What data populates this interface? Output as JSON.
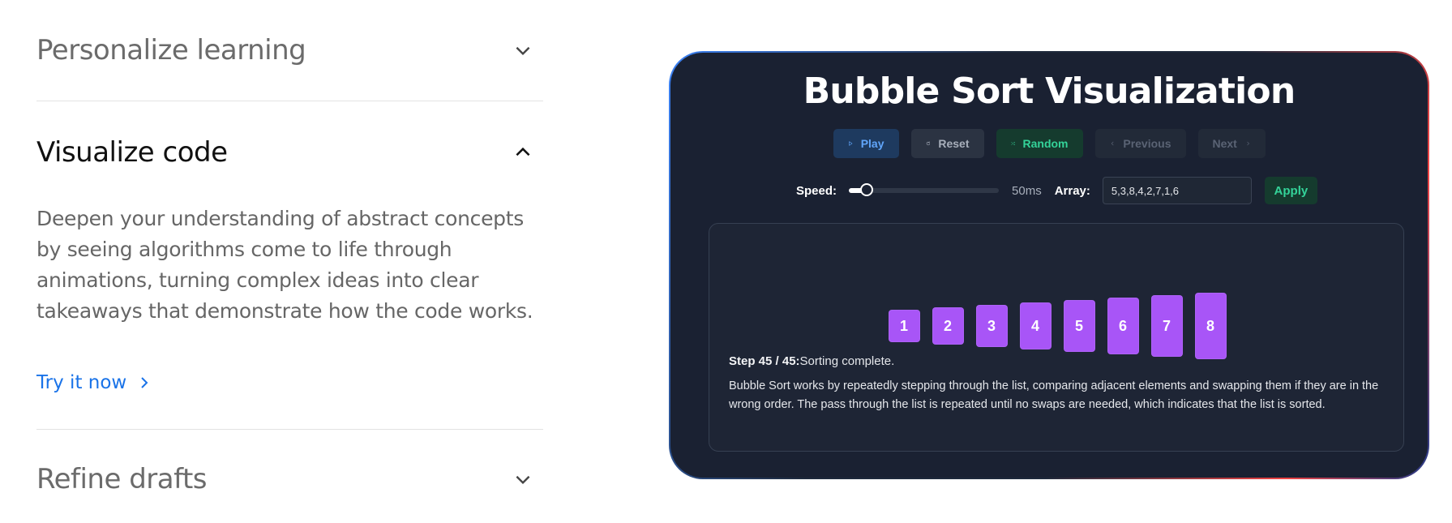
{
  "accordion": {
    "items": [
      {
        "title": "Personalize learning",
        "expanded": false,
        "chevron": "chevron-down-icon"
      },
      {
        "title": "Visualize code",
        "expanded": true,
        "chevron": "chevron-up-icon",
        "description": "Deepen your understanding of abstract concepts by seeing algorithms come to life through animations, turning complex ideas into clear takeaways that demonstrate how the code works.",
        "link_label": "Try it now"
      },
      {
        "title": "Refine drafts",
        "expanded": false,
        "chevron": "chevron-down-icon"
      }
    ]
  },
  "demo": {
    "title": "Bubble Sort Visualization",
    "controls": {
      "play": "Play",
      "reset": "Reset",
      "random": "Random",
      "previous": "Previous",
      "next": "Next"
    },
    "speed_label": "Speed:",
    "speed_value": "50ms",
    "speed_level": 0.12,
    "array_label": "Array:",
    "array_value": "5,3,8,4,2,7,1,6",
    "apply_label": "Apply",
    "bars": [
      {
        "value": "1",
        "n": 1
      },
      {
        "value": "2",
        "n": 2
      },
      {
        "value": "3",
        "n": 3
      },
      {
        "value": "4",
        "n": 4
      },
      {
        "value": "5",
        "n": 5
      },
      {
        "value": "6",
        "n": 6
      },
      {
        "value": "7",
        "n": 7
      },
      {
        "value": "8",
        "n": 8
      }
    ],
    "step_label": "Step 45 / 45:",
    "step_status": "Sorting complete.",
    "explanation": "Bubble Sort works by repeatedly stepping through the list, comparing adjacent elements and swapping them if they are in the wrong order. The pass through the list is repeated until no swaps are needed, which indicates that the list is sorted."
  },
  "colors": {
    "link": "#1a73e8",
    "bar": "#a855f7",
    "card_bg": "#1a2132",
    "play": "#60a5fa",
    "success": "#34d399"
  }
}
